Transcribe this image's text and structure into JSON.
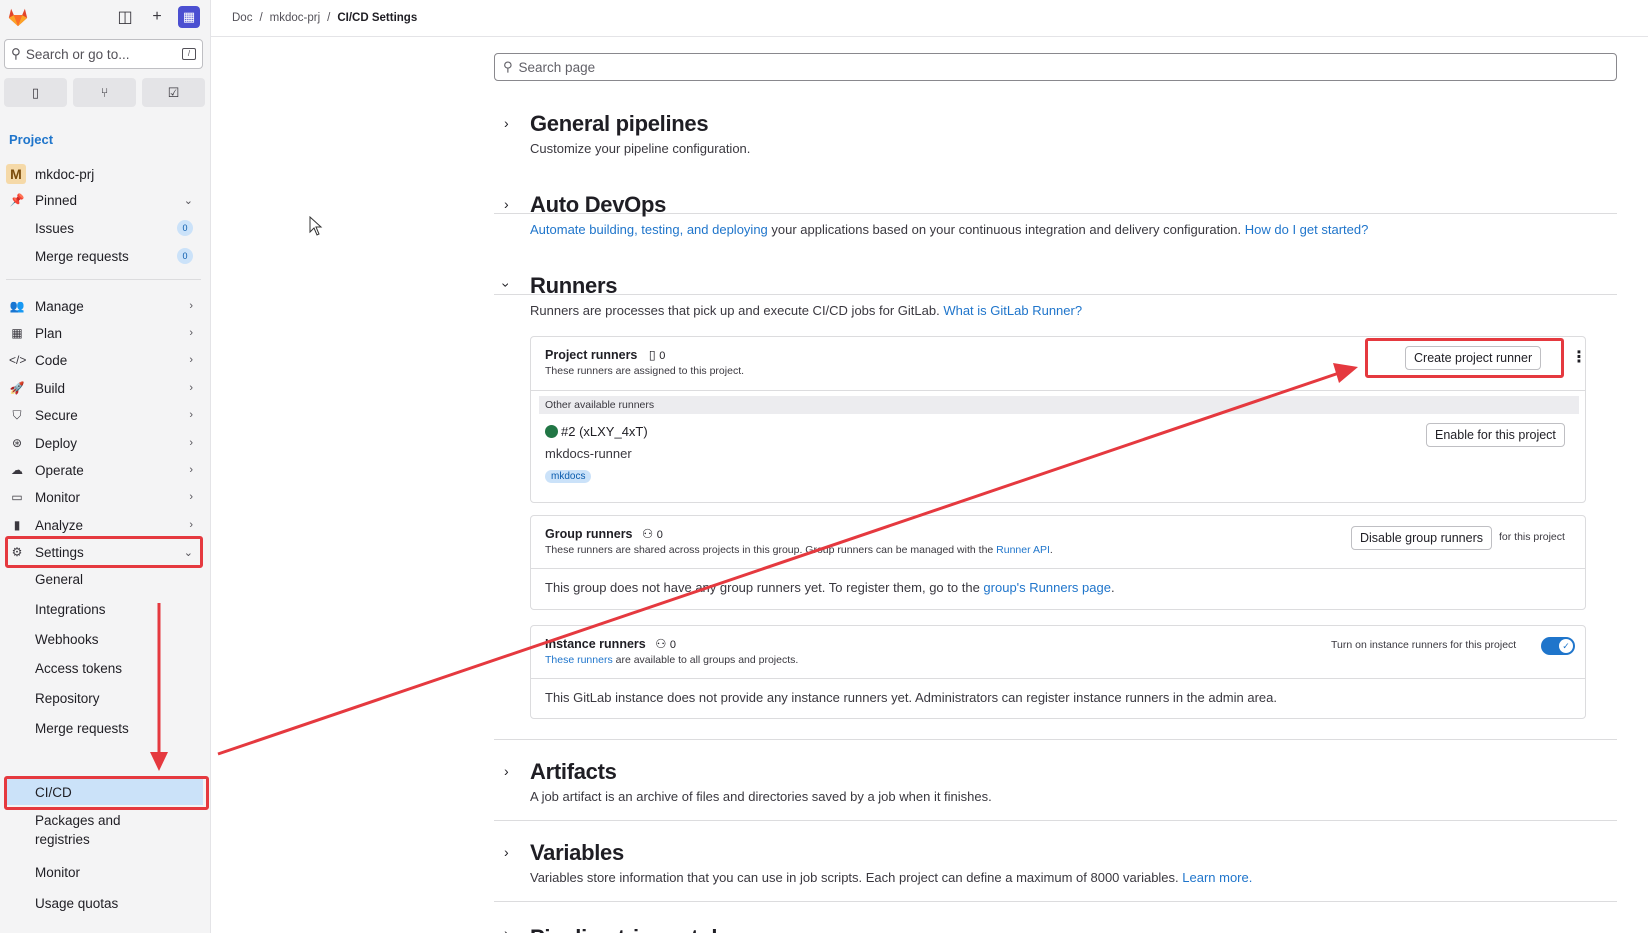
{
  "sidebar": {
    "search_placeholder": "Search or go to...",
    "section_label": "Project",
    "project_avatar": "M",
    "project_name": "mkdoc-prj",
    "pinned": {
      "label": "Pinned",
      "items": [
        {
          "label": "Issues",
          "count": "0"
        },
        {
          "label": "Merge requests",
          "count": "0"
        }
      ]
    },
    "items": [
      {
        "label": "Manage",
        "icon": "users-icon"
      },
      {
        "label": "Plan",
        "icon": "calendar-icon"
      },
      {
        "label": "Code",
        "icon": "code-icon"
      },
      {
        "label": "Build",
        "icon": "rocket-icon"
      },
      {
        "label": "Secure",
        "icon": "shield-icon"
      },
      {
        "label": "Deploy",
        "icon": "deploy-icon"
      },
      {
        "label": "Operate",
        "icon": "cloud-icon"
      },
      {
        "label": "Monitor",
        "icon": "monitor-icon"
      },
      {
        "label": "Analyze",
        "icon": "chart-icon"
      }
    ],
    "settings": {
      "label": "Settings",
      "items": [
        "General",
        "Integrations",
        "Webhooks",
        "Access tokens",
        "Repository",
        "Merge requests",
        "CI/CD",
        "Packages and\nregistries",
        "Monitor",
        "Usage quotas"
      ]
    }
  },
  "breadcrumb": [
    "Doc",
    "mkdoc-prj",
    "CI/CD Settings"
  ],
  "main": {
    "search_placeholder": "Search page",
    "general_pipelines": {
      "title": "General pipelines",
      "desc": "Customize your pipeline configuration."
    },
    "auto_devops": {
      "title": "Auto DevOps",
      "link1": "Automate building, testing, and deploying",
      "text": " your applications based on your continuous integration and delivery configuration. ",
      "link2": "How do I get started?"
    },
    "runners": {
      "title": "Runners",
      "desc": "Runners are processes that pick up and execute CI/CD jobs for GitLab. ",
      "desc_link": "What is GitLab Runner?",
      "project_runners": {
        "title": "Project runners",
        "count": "0",
        "subtitle": "These runners are assigned to this project.",
        "create_button": "Create project runner",
        "other_label": "Other available runners",
        "runner_name": "#2 (xLXY_4xT)",
        "runner_desc": "mkdocs-runner",
        "runner_tag": "mkdocs",
        "enable_button": "Enable for this project"
      },
      "group_runners": {
        "title": "Group runners",
        "count": "0",
        "subtitle": "These runners are shared across projects in this group. Group runners can be managed with the ",
        "subtitle_link": "Runner API",
        "subtitle_end": ".",
        "disable_button": "Disable group runners",
        "for_project": "for this project",
        "empty_text": "This group does not have any group runners yet. To register them, go to the ",
        "empty_link": "group's Runners page",
        "empty_end": "."
      },
      "instance_runners": {
        "title": "Instance runners",
        "count": "0",
        "subtitle_link": "These runners",
        "subtitle": " are available to all groups and projects.",
        "toggle_label": "Turn on instance runners for this project",
        "toggle_on": true,
        "empty_text": "This GitLab instance does not provide any instance runners yet. Administrators can register instance runners in the admin area."
      }
    },
    "artifacts": {
      "title": "Artifacts",
      "desc": "A job artifact is an archive of files and directories saved by a job when it finishes."
    },
    "variables": {
      "title": "Variables",
      "desc": "Variables store information that you can use in job scripts. Each project can define a maximum of 8000 variables. ",
      "link": "Learn more."
    },
    "next_partial": "Pipeline trigger tokens"
  },
  "colors": {
    "annotation": "#e5393f",
    "link": "#1f75cb",
    "runner_online": "#217645"
  }
}
